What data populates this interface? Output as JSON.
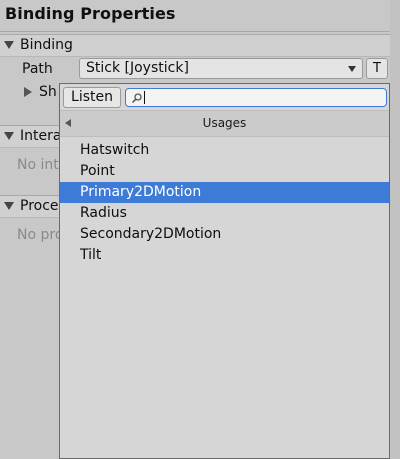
{
  "panel": {
    "title": "Binding Properties"
  },
  "binding_section": {
    "label": "Binding",
    "path_label": "Path",
    "path_value": "Stick [Joystick]",
    "t_button_label": "T",
    "sub_label": "Sh"
  },
  "interactions_section": {
    "label": "Intera",
    "empty_text": "No int"
  },
  "processors_section": {
    "label": "Proce",
    "empty_text": "No pro"
  },
  "popup": {
    "listen_label": "Listen",
    "search_value": "",
    "nav_title": "Usages",
    "items": [
      {
        "label": "Hatswitch",
        "selected": false
      },
      {
        "label": "Point",
        "selected": false
      },
      {
        "label": "Primary2DMotion",
        "selected": true
      },
      {
        "label": "Radius",
        "selected": false
      },
      {
        "label": "Secondary2DMotion",
        "selected": false
      },
      {
        "label": "Tilt",
        "selected": false
      }
    ]
  },
  "colors": {
    "selection": "#3e7bd6",
    "panel_bg": "#c8c8c8"
  }
}
